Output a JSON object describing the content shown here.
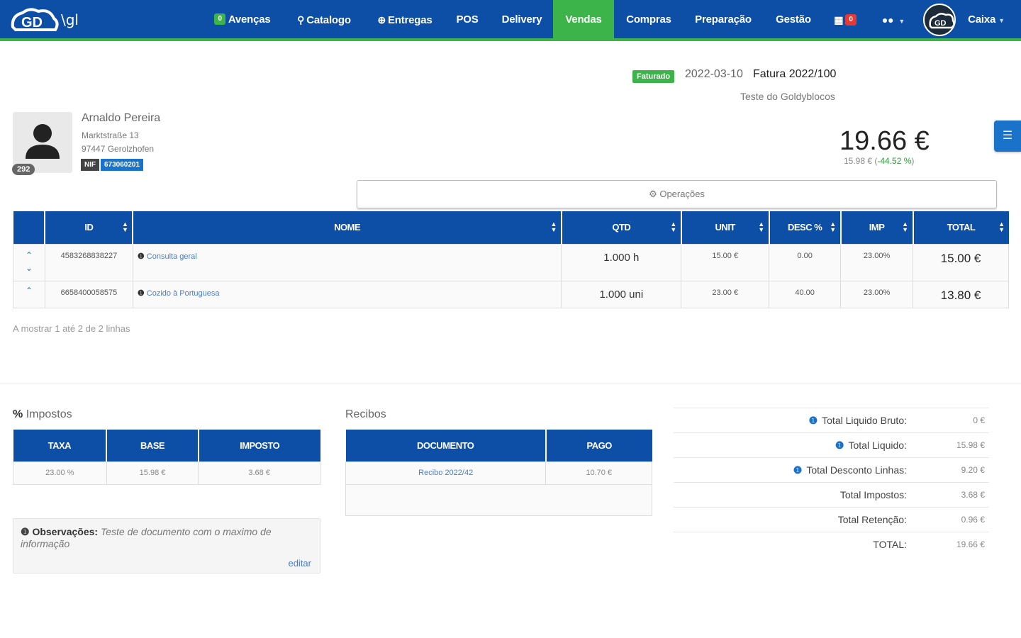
{
  "app": {
    "logo_sub": "\\gl"
  },
  "nav": {
    "items": [
      {
        "label": "Avenças",
        "badge": "0"
      },
      {
        "label": "Catalogo"
      },
      {
        "label": "Entregas"
      },
      {
        "label": "POS"
      },
      {
        "label": "Delivery"
      },
      {
        "label": "Vendas",
        "active": true
      },
      {
        "label": "Compras"
      },
      {
        "label": "Preparação"
      },
      {
        "label": "Gestão"
      }
    ],
    "calendar_badge": "0",
    "user_label": "Caixa"
  },
  "document": {
    "status": "Faturado",
    "date": "2022-03-10",
    "title": "Fatura 2022/100",
    "subtitle": "Teste do Goldyblocos"
  },
  "client": {
    "name": "Arnaldo Pereira",
    "address_line1": "Marktstraße 13",
    "address_line2": "97447 Gerolzhofen",
    "badge": "292",
    "nif_label": "NIF",
    "nif_value": "673060201"
  },
  "totals_header": {
    "total": "19.66 €",
    "sub_base": "15.98 € (",
    "sub_pct": "-44.52 %",
    "sub_close": ")"
  },
  "operations_label": "Operações",
  "items_table": {
    "headers": [
      "ID",
      "NOME",
      "QTD",
      "UNIT",
      "DESC %",
      "IMP",
      "TOTAL"
    ],
    "rows": [
      {
        "id": "4583268838227",
        "nome": "Consulta geral",
        "qtd": "1.000 h",
        "unit": "15.00 €",
        "desc": "0.00",
        "imp": "23.00%",
        "total": "15.00 €"
      },
      {
        "id": "6658400058575",
        "nome": "Cozido à Portuguesa",
        "qtd": "1.000 uni",
        "unit": "23.00 €",
        "desc": "40.00",
        "imp": "23.00%",
        "total": "13.80 €"
      }
    ],
    "rows_info": "A mostrar 1 até 2 de 2 linhas"
  },
  "taxes": {
    "title": "Impostos",
    "headers": [
      "TAXA",
      "BASE",
      "IMPOSTO"
    ],
    "row": [
      "23.00 %",
      "15.98 €",
      "3.68 €"
    ]
  },
  "receipts": {
    "title": "Recibos",
    "headers": [
      "DOCUMENTO",
      "PAGO"
    ],
    "row": [
      "Recibo 2022/42",
      "10.70 €"
    ]
  },
  "observations": {
    "label": "Observações:",
    "text": "Teste de documento com o maximo de informação",
    "edit": "editar"
  },
  "summary": [
    {
      "label": "Total Liquido Bruto:",
      "value": "0 €",
      "info": true
    },
    {
      "label": "Total Liquido:",
      "value": "15.98 €",
      "info": true
    },
    {
      "label": "Total Desconto Linhas:",
      "value": "9.20 €",
      "info": true
    },
    {
      "label": "Total Impostos:",
      "value": "3.68 €",
      "info": false
    },
    {
      "label": "Total Retenção:",
      "value": "0.96 €",
      "info": false
    },
    {
      "label": "TOTAL:",
      "value": "19.66 €",
      "info": false
    }
  ],
  "colors": {
    "primary": "#0d4ea6",
    "accent": "#3cb44a",
    "link": "#4a7cc7"
  }
}
